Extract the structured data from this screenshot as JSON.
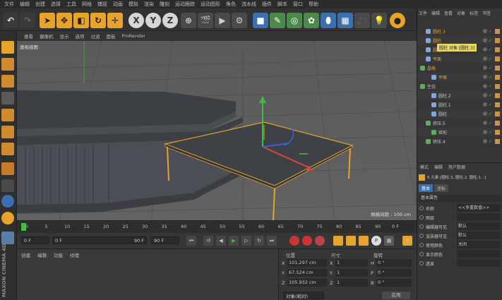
{
  "menubar": {
    "items": [
      "文件",
      "编辑",
      "创建",
      "选择",
      "工具",
      "网格",
      "捕捉",
      "动画",
      "模拟",
      "渲染",
      "雕刻",
      "运动跟踪",
      "运动图形",
      "角色",
      "流水线",
      "插件",
      "脚本",
      "窗口",
      "帮助"
    ]
  },
  "toolbar": {
    "axis_x": "X",
    "axis_y": "Y",
    "axis_z": "Z",
    "colors": {
      "accent_orange": "#e8a32a",
      "active_blue": "#3b6fae"
    }
  },
  "viewport": {
    "menu": [
      "查看",
      "摄像机",
      "显示",
      "选项",
      "过滤",
      "面板",
      "ProRender"
    ],
    "label": "透视视图",
    "grid_label": "网格间距 : 100 cm"
  },
  "timeline": {
    "ticks": [
      "0",
      "5",
      "10",
      "15",
      "20",
      "25",
      "30",
      "35",
      "40",
      "45",
      "50",
      "55",
      "60",
      "65",
      "70",
      "75",
      "80",
      "85",
      "90"
    ],
    "end_label": "0 F"
  },
  "transport": {
    "start": "0 F",
    "current": "0 F",
    "end_field": "90 F",
    "end": "90 F"
  },
  "material": {
    "menu": [
      "创建",
      "编辑",
      "功能",
      "纹理"
    ]
  },
  "coords": {
    "headers": [
      "位置",
      "尺寸",
      "旋转"
    ],
    "rows": [
      {
        "axis": "X",
        "pos": "101.297 cm",
        "size_axis": "X",
        "size": "1",
        "rot_axis": "H",
        "rot": "0 °"
      },
      {
        "axis": "Y",
        "pos": "67.524 cm",
        "size_axis": "Y",
        "size": "1",
        "rot_axis": "P",
        "rot": "0 °"
      },
      {
        "axis": "Z",
        "pos": "105.932 cm",
        "size_axis": "Z",
        "size": "1",
        "rot_axis": "B",
        "rot": "0 °"
      }
    ],
    "mode": "对象(相对)",
    "apply": "应用"
  },
  "objmgr": {
    "tabs": [
      "文件",
      "编辑",
      "查看",
      "对象",
      "标签",
      "书签"
    ],
    "tooltip": "圆柱 对象 [圆柱.3]",
    "items": [
      {
        "label": "圆柱.3",
        "indent": 1,
        "color": "#e8a32a",
        "icon": "cylinder-icon"
      },
      {
        "label": "圆柱",
        "indent": 1,
        "color": "#e8a32a",
        "icon": "cylinder-icon"
      },
      {
        "label": "圆柱",
        "indent": 1,
        "color": "#e8a32a",
        "icon": "cylinder-icon"
      },
      {
        "label": "平面",
        "indent": 1,
        "color": "#e8a32a",
        "icon": "plane-icon"
      },
      {
        "label": "晶格",
        "indent": 0,
        "color": "#e8a32a",
        "icon": "lattice-icon"
      },
      {
        "label": "平面",
        "indent": 2,
        "color": "#e8a32a",
        "icon": "plane-icon"
      },
      {
        "label": "空白",
        "indent": 0,
        "color": "#c8c8c8",
        "icon": "null-icon"
      },
      {
        "label": "圆柱.2",
        "indent": 2,
        "color": "#c8c8c8",
        "icon": "cylinder-icon"
      },
      {
        "label": "圆柱.1",
        "indent": 2,
        "color": "#c8c8c8",
        "icon": "cylinder-icon"
      },
      {
        "label": "圆柱",
        "indent": 2,
        "color": "#c8c8c8",
        "icon": "cylinder-icon"
      },
      {
        "label": "挤压.5",
        "indent": 1,
        "color": "#c8c8c8",
        "icon": "extrude-icon"
      },
      {
        "label": "矩形",
        "indent": 2,
        "color": "#c8c8c8",
        "icon": "rectangle-icon"
      },
      {
        "label": "挤压.4",
        "indent": 1,
        "color": "#c8c8c8",
        "icon": "extrude-icon"
      }
    ]
  },
  "attr": {
    "tabs": [
      "模式",
      "编辑",
      "用户数据"
    ],
    "selection": "6 元素 [圆柱.3, 圆柱.2, 圆柱.1...]",
    "subtabs": [
      "基本",
      "坐标"
    ],
    "section": "基本属性",
    "fields": [
      {
        "label": "名称",
        "value": "<<多重数值>>"
      },
      {
        "label": "图层",
        "value": ""
      },
      {
        "label": "编辑器可见",
        "value": "默认"
      },
      {
        "label": "渲染器可见",
        "value": "默认"
      },
      {
        "label": "使用颜色",
        "value": "关闭"
      },
      {
        "label": "显示颜色",
        "value": ""
      },
      {
        "label": "透显",
        "value": ""
      }
    ]
  },
  "sidebar_brand": "MAXON CINEMA 4D"
}
